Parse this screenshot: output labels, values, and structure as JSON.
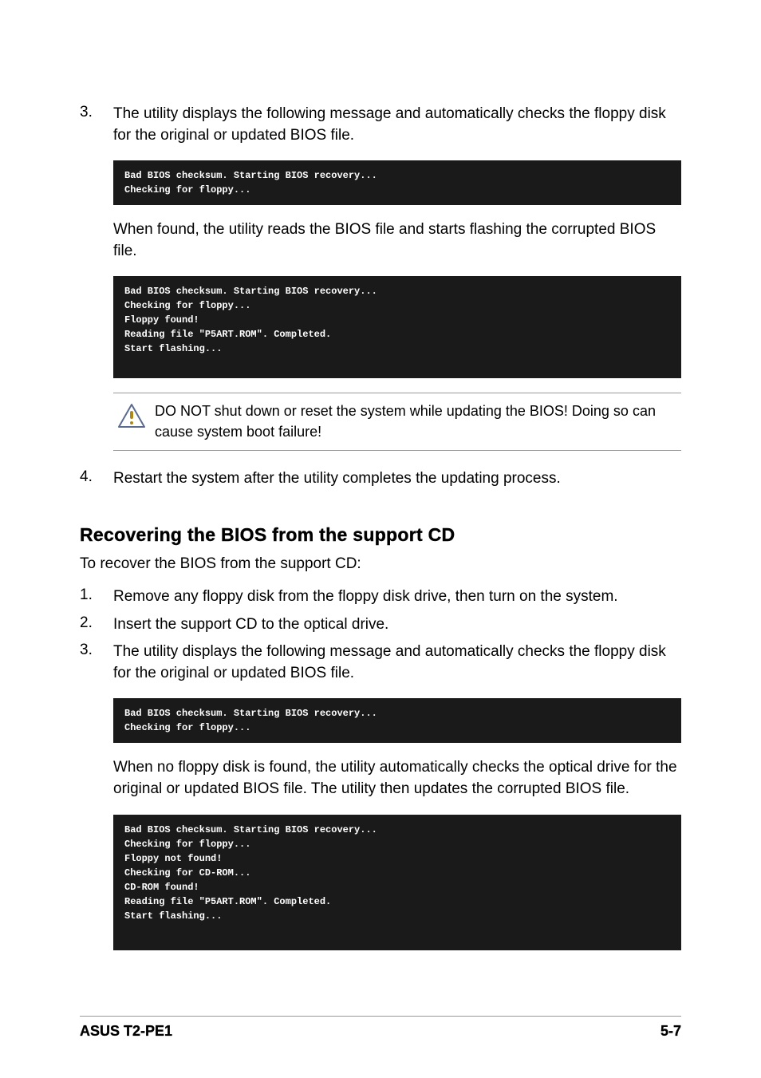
{
  "steps_top": [
    {
      "num": "3.",
      "text": "The utility displays the following message and automatically checks the floppy disk for the original or updated BIOS file."
    }
  ],
  "code1": "Bad BIOS checksum. Starting BIOS recovery...\nChecking for floppy...",
  "para_after_code1": "When found, the utility reads the BIOS file and starts flashing the corrupted BIOS file.",
  "code2": "Bad BIOS checksum. Starting BIOS recovery...\nChecking for floppy...\nFloppy found!\nReading file \"P5ART.ROM\". Completed.\nStart flashing...",
  "callout_text": "DO NOT shut down or reset the system while updating the BIOS! Doing so can cause system boot failure!",
  "step4": {
    "num": "4.",
    "text": "Restart the system after the utility completes the updating process."
  },
  "section_heading": "Recovering the BIOS from the support CD",
  "section_intro": "To recover the BIOS from the support CD:",
  "steps_cd": [
    {
      "num": "1.",
      "text": "Remove any floppy disk from the floppy disk drive, then turn on the system."
    },
    {
      "num": "2.",
      "text": "Insert the support CD to the optical drive."
    },
    {
      "num": "3.",
      "text": "The utility displays the following message and automatically checks the floppy disk for the original or updated BIOS file."
    }
  ],
  "code3": "Bad BIOS checksum. Starting BIOS recovery...\nChecking for floppy...",
  "para_after_code3": "When no floppy disk is found, the utility automatically checks the optical drive for the original or updated BIOS file. The utility then updates the corrupted BIOS file.",
  "code4": "Bad BIOS checksum. Starting BIOS recovery...\nChecking for floppy...\nFloppy not found!\nChecking for CD-ROM...\nCD-ROM found!\nReading file \"P5ART.ROM\". Completed.\nStart flashing...",
  "footer_left": "ASUS T2-PE1",
  "footer_right": "5-7"
}
